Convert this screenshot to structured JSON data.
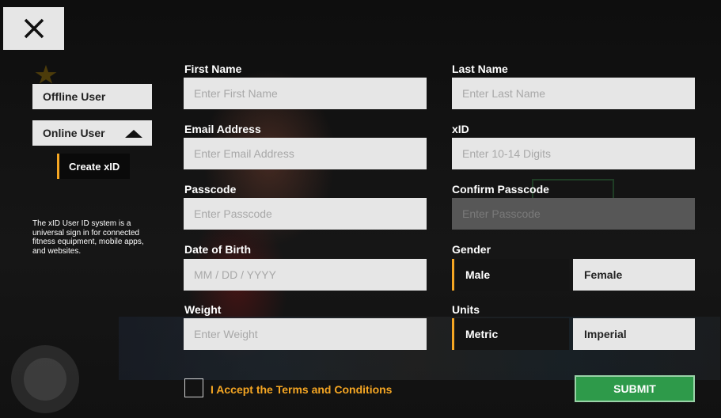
{
  "close": {
    "icon": "close-icon"
  },
  "sidebar": {
    "offline_user": "Offline User",
    "online_user": "Online User",
    "create_xid": "Create xID",
    "info": "The xID User ID system is a universal sign in for connected fitness equipment, mobile apps, and websites."
  },
  "form": {
    "first_name": {
      "label": "First Name",
      "placeholder": "Enter First Name"
    },
    "last_name": {
      "label": "Last Name",
      "placeholder": "Enter Last Name"
    },
    "email": {
      "label": "Email Address",
      "placeholder": "Enter Email Address"
    },
    "xid": {
      "label": "xID",
      "placeholder": "Enter 10-14 Digits"
    },
    "passcode": {
      "label": "Passcode",
      "placeholder": "Enter Passcode"
    },
    "confirm_passcode": {
      "label": "Confirm Passcode",
      "placeholder": "Enter Passcode"
    },
    "dob": {
      "label": "Date of Birth",
      "placeholder": "MM / DD / YYYY"
    },
    "gender": {
      "label": "Gender",
      "options": [
        "Male",
        "Female"
      ],
      "selected": "Male"
    },
    "weight": {
      "label": "Weight",
      "placeholder": "Enter Weight"
    },
    "units": {
      "label": "Units",
      "options": [
        "Metric",
        "Imperial"
      ],
      "selected": "Metric"
    },
    "terms": "I Accept the Terms and Conditions",
    "submit": "SUBMIT"
  },
  "colors": {
    "accent": "#f5a623",
    "submit": "#2e9a4a",
    "field_bg": "#e6e6e6",
    "disabled_field": "#575757"
  }
}
